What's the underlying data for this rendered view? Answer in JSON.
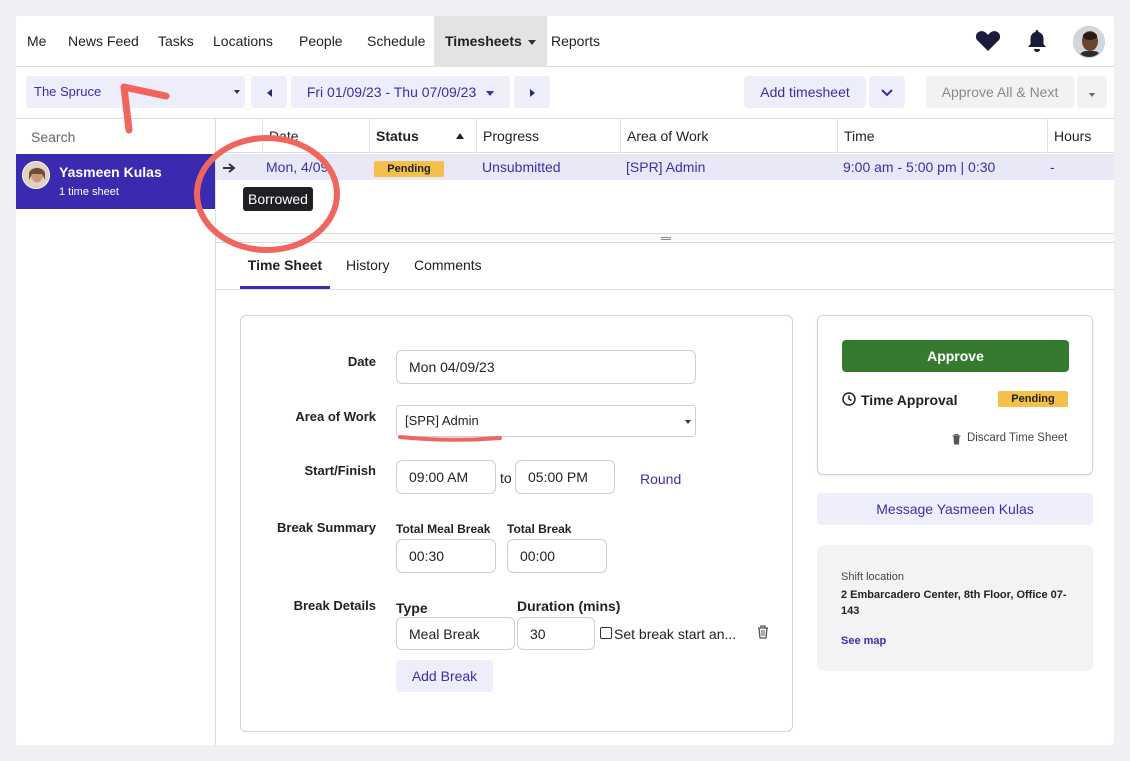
{
  "nav": {
    "items": [
      "Me",
      "News Feed",
      "Tasks",
      "Locations",
      "People",
      "Schedule"
    ],
    "active": "Timesheets",
    "after": "Reports"
  },
  "icons": {
    "favorites": "heart-icon",
    "notifications": "bell-icon",
    "user": "avatar"
  },
  "toolbar": {
    "location": "The Spruce",
    "date_range": "Fri 01/09/23 - Thu 07/09/23",
    "add_timesheet": "Add timesheet",
    "approve_all": "Approve All & Next"
  },
  "sidebar": {
    "search_placeholder": "Search",
    "person": {
      "name": "Yasmeen Kulas",
      "sub": "1 time sheet"
    }
  },
  "table": {
    "headers": [
      "Date",
      "Status",
      "Progress",
      "Area of Work",
      "Time",
      "Hours"
    ],
    "row": {
      "date": "Mon, 4/09",
      "status": "Pending",
      "progress": "Unsubmitted",
      "area": "[SPR] Admin",
      "time": "9:00 am - 5:00 pm | 0:30",
      "hours": "-"
    },
    "tooltip": "Borrowed"
  },
  "tabs": [
    "Time Sheet",
    "History",
    "Comments"
  ],
  "form": {
    "date_label": "Date",
    "date_value": "Mon 04/09/23",
    "area_label": "Area of Work",
    "area_value": "[SPR] Admin",
    "start_finish_label": "Start/Finish",
    "start_value": "09:00 AM",
    "to": "to",
    "finish_value": "05:00 PM",
    "round": "Round",
    "break_summary_label": "Break Summary",
    "total_meal_break_label": "Total Meal Break",
    "total_meal_break_value": "00:30",
    "total_break_label": "Total Break",
    "total_break_value": "00:00",
    "break_details_label": "Break Details",
    "type_label": "Type",
    "duration_label": "Duration (mins)",
    "break_type": "Meal Break",
    "break_duration": "30",
    "set_break_start": "Set break start an...",
    "add_break": "Add Break"
  },
  "approval": {
    "approve": "Approve",
    "time_approval": "Time Approval",
    "status": "Pending",
    "discard": "Discard Time Sheet",
    "message": "Message Yasmeen Kulas"
  },
  "location": {
    "label": "Shift location",
    "address": "2 Embarcadero Center, 8th Floor, Office 07-143",
    "see_map": "See map"
  },
  "colors": {
    "brand": "#3a2ab0",
    "approve": "#357a2e",
    "pending": "#f4c04a",
    "annotation": "#f0665e"
  }
}
